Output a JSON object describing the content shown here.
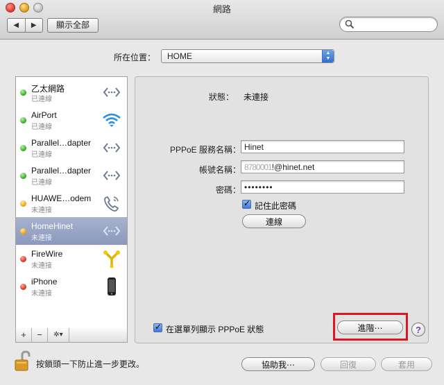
{
  "window": {
    "title": "網路"
  },
  "toolbar": {
    "back_glyph": "◀",
    "forward_glyph": "▶",
    "show_all_label": "顯示全部",
    "search_placeholder": ""
  },
  "location": {
    "label": "所在位置：",
    "value": "HOME"
  },
  "services": [
    {
      "name": "乙太網路",
      "status": "已連線",
      "status_color": "green",
      "icon": "ethernet-icon"
    },
    {
      "name": "AirPort",
      "status": "已連線",
      "status_color": "green",
      "icon": "wifi-icon"
    },
    {
      "name": "Parallel…dapter",
      "status": "已連線",
      "status_color": "green",
      "icon": "ethernet-icon"
    },
    {
      "name": "Parallel…dapter",
      "status": "已連線",
      "status_color": "green",
      "icon": "ethernet-icon"
    },
    {
      "name": "HUAWE…odem",
      "status": "未連接",
      "status_color": "yellow",
      "icon": "modem-phone-icon"
    },
    {
      "name": "HomeHinet",
      "status": "未連接",
      "status_color": "yellow",
      "icon": "ethernet-icon",
      "selected": true
    },
    {
      "name": "FireWire",
      "status": "未連接",
      "status_color": "red",
      "icon": "firewire-icon"
    },
    {
      "name": "iPhone",
      "status": "未連接",
      "status_color": "red",
      "icon": "iphone-icon"
    }
  ],
  "sidebar_actions": {
    "add": "+",
    "remove": "−",
    "gear": "✲▾"
  },
  "detail": {
    "status_label": "狀態：",
    "status_value": "未連接",
    "service_name_label": "PPPoE 服務名稱：",
    "service_name_value": "Hinet",
    "account_label": "帳號名稱：",
    "account_value_obscured": "8780001",
    "account_value": "!@hinet.net",
    "password_label": "密碼：",
    "password_value": "••••••••",
    "remember_label": "記住此密碼",
    "connect_label": "連線",
    "show_menu_label": "在選單列顯示 PPPoE 狀態",
    "advanced_label": "進階⋯",
    "help_label": "?"
  },
  "footer": {
    "lock_text": "按鎖頭一下防止進一步更改。",
    "assist_label": "協助我⋯",
    "revert_label": "回復",
    "apply_label": "套用"
  },
  "colors": {
    "highlight_box": "#e01523",
    "selected_row": "#8a98ba"
  }
}
